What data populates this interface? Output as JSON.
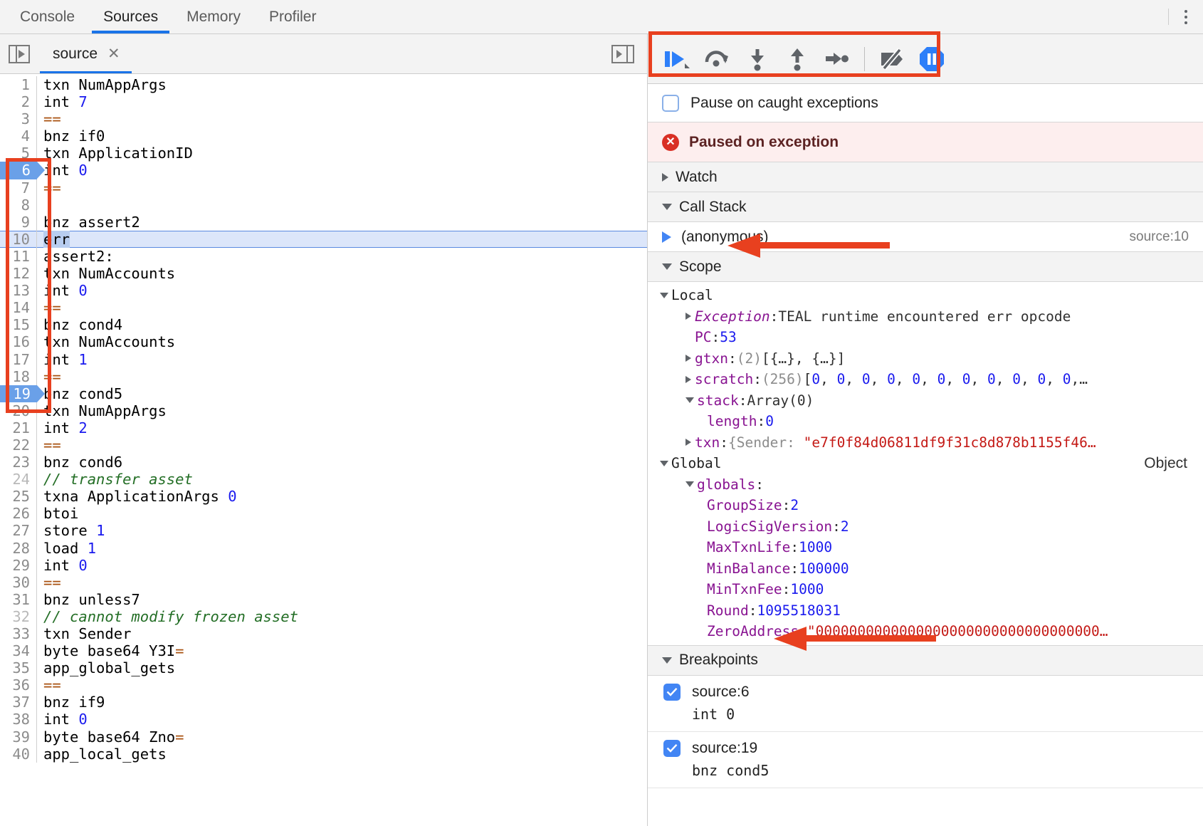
{
  "window": {
    "panel_tabs": [
      {
        "label": "Console",
        "active": false
      },
      {
        "label": "Sources",
        "active": true
      },
      {
        "label": "Memory",
        "active": false
      },
      {
        "label": "Profiler",
        "active": false
      }
    ],
    "more_options_icon": "kebab-menu-icon"
  },
  "editor": {
    "navigator_toggle_icon": "show-navigator-icon",
    "pane_expand_icon": "show-debugger-icon",
    "file_tab": {
      "label": "source",
      "close_icon": "close-icon"
    },
    "lines": [
      {
        "n": 1,
        "text": "txn NumAppArgs",
        "type": "code"
      },
      {
        "n": 2,
        "text": "int 7",
        "type": "code",
        "num": "7"
      },
      {
        "n": 3,
        "text": "==",
        "type": "op"
      },
      {
        "n": 4,
        "text": "bnz if0",
        "type": "code"
      },
      {
        "n": 5,
        "text": "txn ApplicationID",
        "type": "code"
      },
      {
        "n": 6,
        "text": "int 0",
        "type": "code",
        "num": "0",
        "breakpoint": true
      },
      {
        "n": 7,
        "text": "==",
        "type": "op"
      },
      {
        "n": 8,
        "text": "",
        "type": "code"
      },
      {
        "n": 9,
        "text": "bnz assert2",
        "type": "code"
      },
      {
        "n": 10,
        "text": "err",
        "type": "code",
        "executing": true,
        "selected": true
      },
      {
        "n": 11,
        "text": "assert2:",
        "type": "code"
      },
      {
        "n": 12,
        "text": "txn NumAccounts",
        "type": "code"
      },
      {
        "n": 13,
        "text": "int 0",
        "type": "code",
        "num": "0"
      },
      {
        "n": 14,
        "text": "==",
        "type": "op"
      },
      {
        "n": 15,
        "text": "bnz cond4",
        "type": "code"
      },
      {
        "n": 16,
        "text": "txn NumAccounts",
        "type": "code"
      },
      {
        "n": 17,
        "text": "int 1",
        "type": "code",
        "num": "1"
      },
      {
        "n": 18,
        "text": "==",
        "type": "op"
      },
      {
        "n": 19,
        "text": "bnz cond5",
        "type": "code",
        "breakpoint": true
      },
      {
        "n": 20,
        "text": "txn NumAppArgs",
        "type": "code"
      },
      {
        "n": 21,
        "text": "int 2",
        "type": "code",
        "num": "2"
      },
      {
        "n": 22,
        "text": "==",
        "type": "op"
      },
      {
        "n": 23,
        "text": "bnz cond6",
        "type": "code"
      },
      {
        "n": 24,
        "text": "// transfer asset",
        "type": "comment"
      },
      {
        "n": 25,
        "text": "txna ApplicationArgs 0",
        "type": "code",
        "num": "0"
      },
      {
        "n": 26,
        "text": "btoi",
        "type": "code"
      },
      {
        "n": 27,
        "text": "store 1",
        "type": "code",
        "num": "1"
      },
      {
        "n": 28,
        "text": "load 1",
        "type": "code",
        "num": "1"
      },
      {
        "n": 29,
        "text": "int 0",
        "type": "code",
        "num": "0"
      },
      {
        "n": 30,
        "text": "==",
        "type": "op"
      },
      {
        "n": 31,
        "text": "bnz unless7",
        "type": "code"
      },
      {
        "n": 32,
        "text": "// cannot modify frozen asset",
        "type": "comment"
      },
      {
        "n": 33,
        "text": "txn Sender",
        "type": "code"
      },
      {
        "n": 34,
        "text": "byte base64 Y3I=",
        "type": "code",
        "trailing_op": "="
      },
      {
        "n": 35,
        "text": "app_global_gets",
        "type": "code"
      },
      {
        "n": 36,
        "text": "==",
        "type": "op"
      },
      {
        "n": 37,
        "text": "bnz if9",
        "type": "code"
      },
      {
        "n": 38,
        "text": "int 0",
        "type": "code",
        "num": "0"
      },
      {
        "n": 39,
        "text": "byte base64 Zno=",
        "type": "code",
        "trailing_op": "="
      },
      {
        "n": 40,
        "text": "app_local_gets",
        "type": "code"
      }
    ]
  },
  "debugger": {
    "toolbar": [
      {
        "name": "resume-script-execution",
        "icon": "resume-icon"
      },
      {
        "name": "step-over-next-call",
        "icon": "step-over-icon"
      },
      {
        "name": "step-into-next-call",
        "icon": "step-into-icon"
      },
      {
        "name": "step-out-of-current-function",
        "icon": "step-out-icon"
      },
      {
        "name": "step",
        "icon": "step-icon"
      },
      {
        "name": "deactivate-breakpoints",
        "icon": "deactivate-breakpoints-icon"
      },
      {
        "name": "pause-on-exceptions",
        "icon": "pause-octagon-icon"
      }
    ],
    "pause_on_caught": {
      "label": "Pause on caught exceptions",
      "checked": false
    },
    "paused_banner": {
      "text": "Paused on exception",
      "icon": "error-circle-icon"
    },
    "sections": {
      "watch": {
        "label": "Watch",
        "expanded": false
      },
      "call_stack": {
        "label": "Call Stack",
        "expanded": true
      },
      "scope": {
        "label": "Scope",
        "expanded": true
      },
      "breakpoints": {
        "label": "Breakpoints",
        "expanded": true
      }
    },
    "call_stack": [
      {
        "name": "(anonymous)",
        "location": "source:10",
        "active": true
      }
    ],
    "scope": {
      "local": {
        "title": "Local",
        "entries": [
          {
            "key": "Exception",
            "sep": ": ",
            "value": "TEAL runtime encountered err opcode",
            "style": "plain",
            "key_style": "italic",
            "expandable": true,
            "indent": 2
          },
          {
            "key": "PC",
            "sep": ": ",
            "value": "53",
            "style": "num",
            "expandable": false,
            "indent": 2
          },
          {
            "key": "gtxn",
            "sep": ": ",
            "prefix": "(2) ",
            "value": "[{…}, {…}]",
            "style": "plain",
            "expandable": true,
            "indent": 2
          },
          {
            "key": "scratch",
            "sep": ": ",
            "prefix": "(256) ",
            "value": "[0, 0, 0, 0, 0, 0, 0, 0, 0, 0, 0,…",
            "style": "num-list",
            "expandable": true,
            "indent": 2
          },
          {
            "key": "stack",
            "sep": ": ",
            "value": "Array(0)",
            "style": "plain",
            "expandable": true,
            "expanded": true,
            "indent": 2
          },
          {
            "key": "length",
            "sep": ": ",
            "value": "0",
            "style": "num",
            "expandable": false,
            "indent": 3
          },
          {
            "key": "txn",
            "sep": ": ",
            "value": "{Sender: \"e7f0f84d06811df9f31c8d878b1155f46…",
            "style": "obj-str",
            "expandable": true,
            "indent": 2
          }
        ]
      },
      "global": {
        "title": "Global",
        "type_label": "Object",
        "entries": [
          {
            "key": "globals",
            "sep": ":",
            "value": "",
            "style": "plain",
            "expandable": true,
            "expanded": true,
            "indent": 2
          },
          {
            "key": "GroupSize",
            "sep": ": ",
            "value": "2",
            "style": "num",
            "indent": 3
          },
          {
            "key": "LogicSigVersion",
            "sep": ": ",
            "value": "2",
            "style": "num",
            "indent": 3
          },
          {
            "key": "MaxTxnLife",
            "sep": ": ",
            "value": "1000",
            "style": "num",
            "indent": 3
          },
          {
            "key": "MinBalance",
            "sep": ": ",
            "value": "100000",
            "style": "num",
            "indent": 3
          },
          {
            "key": "MinTxnFee",
            "sep": ": ",
            "value": "1000",
            "style": "num",
            "indent": 3
          },
          {
            "key": "Round",
            "sep": ": ",
            "value": "1095518031",
            "style": "num",
            "indent": 3
          },
          {
            "key": "ZeroAddress",
            "sep": ": ",
            "value": "\"0000000000000000000000000000000000…",
            "style": "str",
            "indent": 3
          }
        ]
      }
    },
    "breakpoints": [
      {
        "label": "source:6",
        "code": "int 0",
        "checked": true
      },
      {
        "label": "source:19",
        "code": "bnz cond5",
        "checked": true
      }
    ]
  },
  "annotations": {
    "accent_color": "#e8401f",
    "items": [
      {
        "name": "toolbar-highlight-rect",
        "kind": "rect"
      },
      {
        "name": "breakpoint-gutter-highlight-rect",
        "kind": "rect"
      },
      {
        "name": "scope-arrow",
        "kind": "arrow"
      },
      {
        "name": "breakpoints-arrow",
        "kind": "arrow"
      }
    ]
  }
}
